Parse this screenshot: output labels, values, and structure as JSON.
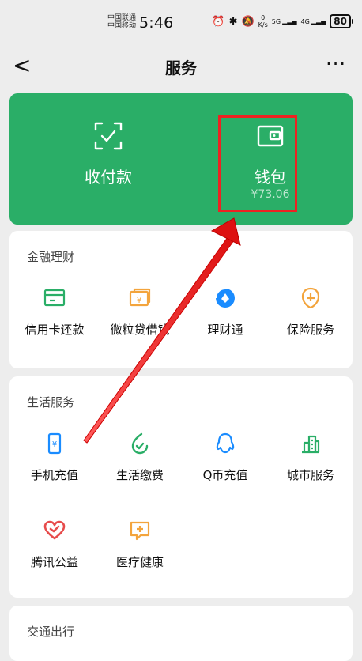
{
  "status_bar": {
    "carrier_1": "中国联通",
    "carrier_2": "中国移动",
    "time": "5:46",
    "net_speed_value": "0",
    "net_speed_unit": "K/s",
    "network_1": "5G",
    "network_2": "4G",
    "battery": "80"
  },
  "header": {
    "back": "<",
    "title": "服务",
    "more": "···"
  },
  "top_card": {
    "left_label": "收付款",
    "right_label": "钱包",
    "right_amount": "¥73.06",
    "accent": "#2aae67"
  },
  "finance": {
    "title": "金融理财",
    "items": [
      {
        "label": "信用卡还款",
        "icon": "credit-card-icon",
        "color": "#2aae67"
      },
      {
        "label": "微粒贷借钱",
        "icon": "loan-icon",
        "color": "#f3a43c"
      },
      {
        "label": "理财通",
        "icon": "wealth-icon",
        "color": "#1a8cff"
      },
      {
        "label": "保险服务",
        "icon": "insurance-icon",
        "color": "#f3a43c"
      }
    ]
  },
  "life": {
    "title": "生活服务",
    "items": [
      {
        "label": "手机充值",
        "icon": "mobile-recharge-icon",
        "color": "#1a8cff"
      },
      {
        "label": "生活缴费",
        "icon": "utility-payment-icon",
        "color": "#2aae67"
      },
      {
        "label": "Q币充值",
        "icon": "qq-coin-icon",
        "color": "#1a8cff"
      },
      {
        "label": "城市服务",
        "icon": "city-service-icon",
        "color": "#2aae67"
      },
      {
        "label": "腾讯公益",
        "icon": "charity-icon",
        "color": "#e74c4c"
      },
      {
        "label": "医疗健康",
        "icon": "medical-icon",
        "color": "#f3a43c"
      }
    ]
  },
  "transport": {
    "title": "交通出行"
  },
  "annotation": {
    "highlight_color": "#e22",
    "arrow_color": "#e22"
  }
}
